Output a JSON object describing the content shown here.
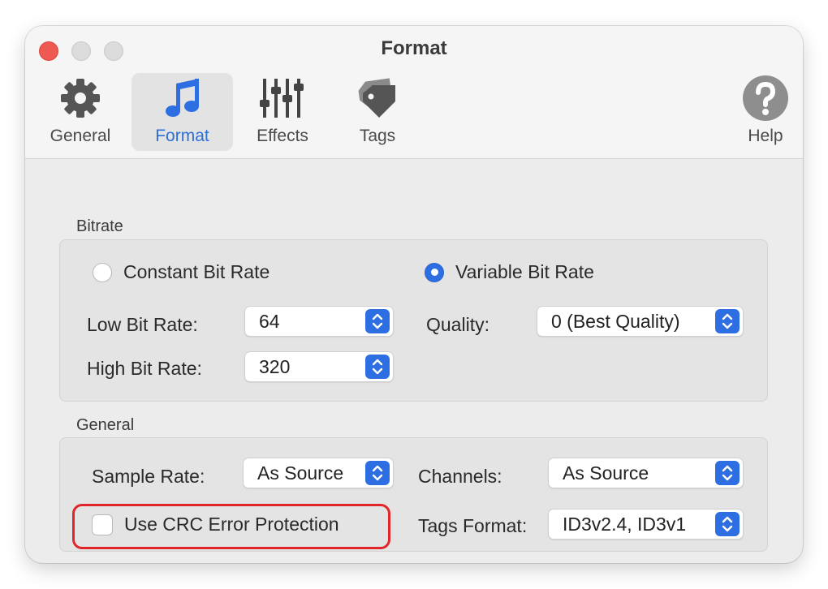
{
  "window": {
    "title": "Format"
  },
  "toolbar": {
    "items": [
      {
        "label": "General",
        "icon": "gear-icon"
      },
      {
        "label": "Format",
        "icon": "music-note-icon",
        "selected": true
      },
      {
        "label": "Effects",
        "icon": "sliders-icon"
      },
      {
        "label": "Tags",
        "icon": "tag-icon"
      },
      {
        "label": "Help",
        "icon": "question-icon"
      }
    ]
  },
  "bitrate": {
    "section_label": "Bitrate",
    "constant_label": "Constant Bit Rate",
    "variable_label": "Variable Bit Rate",
    "selected_mode": "Variable Bit Rate",
    "low_label": "Low Bit Rate:",
    "low_value": "64",
    "high_label": "High Bit Rate:",
    "high_value": "320",
    "quality_label": "Quality:",
    "quality_value": "0 (Best Quality)"
  },
  "general": {
    "section_label": "General",
    "sample_rate_label": "Sample Rate:",
    "sample_rate_value": "As Source",
    "channels_label": "Channels:",
    "channels_value": "As Source",
    "crc_label": "Use CRC Error Protection",
    "crc_checked": false,
    "tags_format_label": "Tags Format:",
    "tags_format_value": "ID3v2.4, ID3v1"
  },
  "colors": {
    "accent": "#2d6fe2",
    "selected_label": "#2d6fd6",
    "highlight": "#e0262a",
    "close": "#ee5a52"
  }
}
